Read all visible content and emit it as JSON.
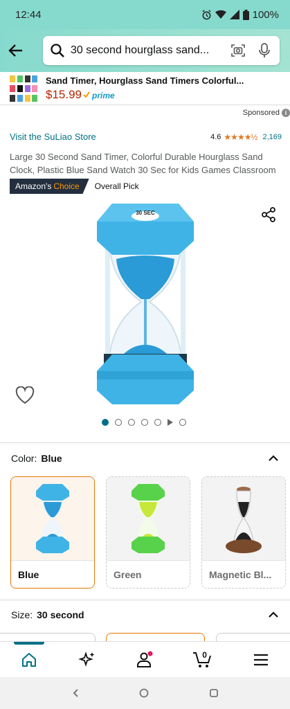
{
  "status": {
    "time": "12:44",
    "battery": "100%"
  },
  "search": {
    "query": "30 second hourglass sand..."
  },
  "ad": {
    "title": "Sand Timer, Hourglass Sand Timers Colorful...",
    "price": "$15.99",
    "prime": "prime"
  },
  "sponsored": "Sponsored",
  "store": {
    "link": "Visit the SuLiao Store",
    "rating": "4.6",
    "stars": "★★★★½",
    "count": "2,169"
  },
  "product": {
    "title": "Large 30 Second Sand Timer, Colorful Durable Hourglass Sand Clock, Plastic Blue Sand Watch 30 Sec for Kids Games Classroom",
    "badge_amazons": "Amazon's",
    "badge_choice": "Choice",
    "overall": "Overall Pick",
    "label_text": "30 SEC"
  },
  "color": {
    "label": "Color:",
    "value": "Blue",
    "options": [
      {
        "label": "Blue",
        "accent": "#36b4e5"
      },
      {
        "label": "Green",
        "accent": "#58d24a"
      },
      {
        "label": "Magnetic Bl...",
        "accent": "#7a4a2c"
      }
    ]
  },
  "size": {
    "label": "Size:",
    "value": "30 second"
  },
  "nav": {
    "cart_count": "0"
  },
  "colors": {
    "teal": "#007185",
    "price": "#B12704",
    "accent": "#e77600",
    "header": "#86dacd"
  }
}
